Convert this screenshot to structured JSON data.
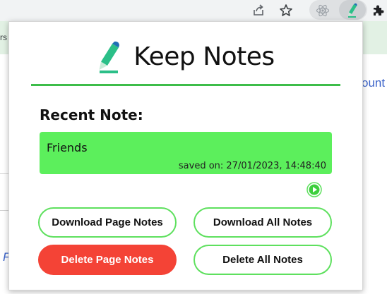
{
  "browser": {
    "icons": [
      "share-icon",
      "star-icon",
      "react-extension-icon",
      "keep-notes-extension-icon",
      "puzzle-icon"
    ]
  },
  "background_page": {
    "left_fragment": "rs",
    "right_link_fragment": "ount",
    "left_link_fragment": "F"
  },
  "popup": {
    "title": "Keep Notes",
    "recent_label": "Recent Note:",
    "note": {
      "text": "Friends",
      "saved": "saved on: 27/01/2023, 14:48:40"
    },
    "buttons": {
      "download_page": "Download Page Notes",
      "download_all": "Download All Notes",
      "delete_page": "Delete Page Notes",
      "delete_all": "Delete All Notes"
    },
    "colors": {
      "accent": "#3dbd4a",
      "note_bg": "#5cef5c",
      "danger": "#f44336",
      "button_border": "#5ee05e"
    }
  }
}
